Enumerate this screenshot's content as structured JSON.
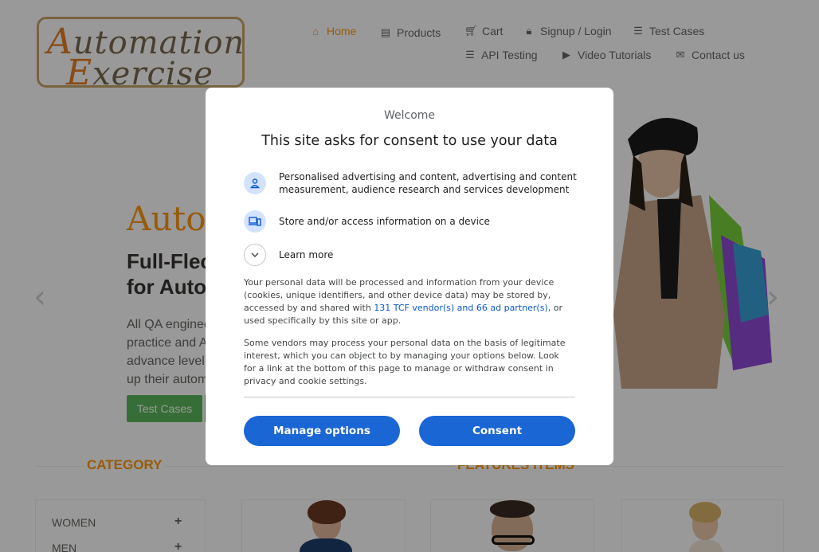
{
  "logo": {
    "line1": "Automation",
    "line2": "Exercise"
  },
  "nav": {
    "home": "Home",
    "products": "Products",
    "cart": "Cart",
    "signup": "Signup / Login",
    "test_cases": "Test Cases",
    "api_testing": "API Testing",
    "video_tutorials": "Video Tutorials",
    "contact": "Contact us"
  },
  "hero": {
    "title": "Auton",
    "subtitle_line1": "Full-Flec",
    "subtitle_line2": "for Autor",
    "text_line1": "All QA enginee",
    "text_line2": "practice and A",
    "text_line3": "advance level.",
    "text_line4": "up their autom",
    "test_cases_button": "Test Cases"
  },
  "sections": {
    "category_title": "CATEGORY",
    "features_title": "FEATURES ITEMS"
  },
  "categories": {
    "women": "WOMEN",
    "men": "MEN"
  },
  "consent": {
    "welcome": "Welcome",
    "title": "This site asks for consent to use your data",
    "purpose1_line1": "Personalised advertising and content, advertising and content",
    "purpose1_line2": "measurement, audience research and services development",
    "purpose2": "Store and/or access information on a device",
    "learn_more": "Learn more",
    "para1_line1": "Your personal data will be processed and information from your device",
    "para1_line2": "(cookies, unique identifiers, and other device data) may be stored by,",
    "para1_line3_pre": "accessed by and shared with ",
    "para1_link": "131 TCF vendor(s) and 66 ad partner(s)",
    "para1_line3_post": ", or",
    "para1_line4": "used specifically by this site or app.",
    "para2_line1": "Some vendors may process your personal data on the basis of legitimate",
    "para2_line2": "interest, which you can object to by managing your options below. Look",
    "para2_line3": "for a link at the bottom of this page to manage or withdraw consent in",
    "para2_line4": "privacy and cookie settings.",
    "manage_button": "Manage options",
    "consent_button": "Consent"
  },
  "colors": {
    "accent": "#fe980f",
    "consent_button": "#1a66d4",
    "link": "#0b57d0",
    "green_button": "#5cb85c"
  }
}
